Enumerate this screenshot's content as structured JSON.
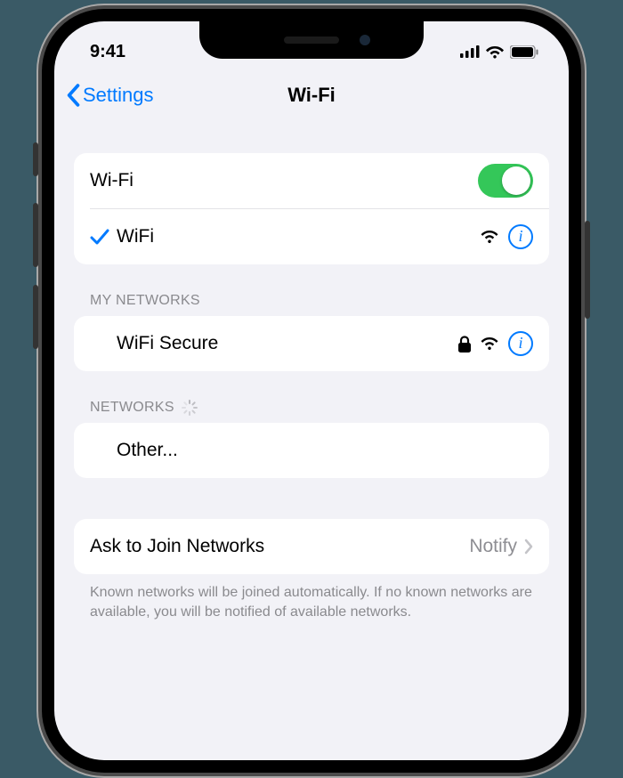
{
  "status": {
    "time": "9:41"
  },
  "nav": {
    "back": "Settings",
    "title": "Wi-Fi"
  },
  "wifi": {
    "toggle_label": "Wi-Fi",
    "toggle_on": true,
    "connected_network": "WiFi"
  },
  "sections": {
    "my_networks": {
      "header": "MY NETWORKS",
      "items": [
        {
          "name": "WiFi Secure",
          "secured": true
        }
      ]
    },
    "networks": {
      "header": "NETWORKS",
      "loading": true,
      "other_label": "Other..."
    }
  },
  "ask_to_join": {
    "label": "Ask to Join Networks",
    "value": "Notify"
  },
  "footer": "Known networks will be joined automatically. If no known networks are available, you will be notified of available networks."
}
